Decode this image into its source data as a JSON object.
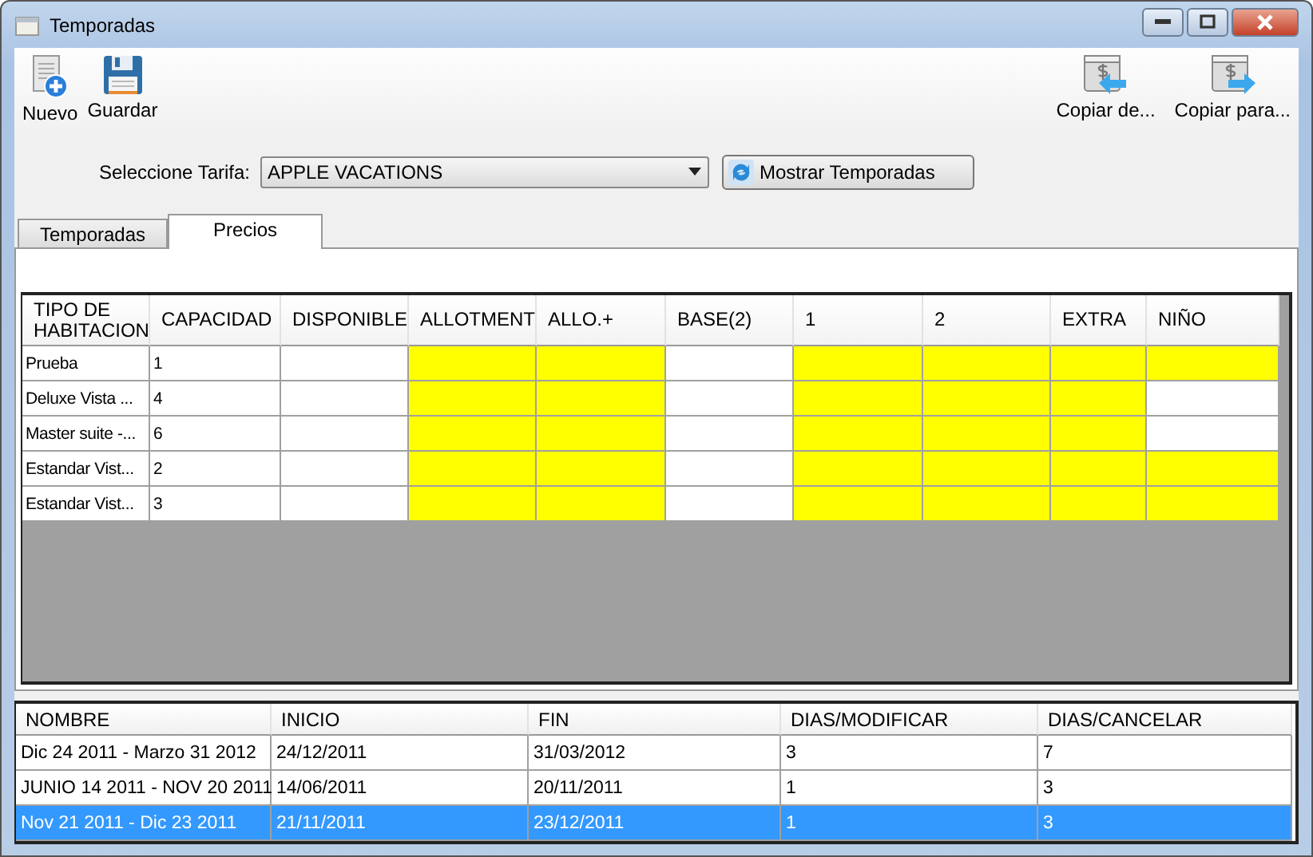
{
  "window": {
    "title": "Temporadas"
  },
  "toolbar_left": [
    {
      "label": "Nuevo",
      "kind": "new"
    },
    {
      "label": "Guardar",
      "kind": "save"
    }
  ],
  "toolbar_right": [
    {
      "label": "Copiar de...",
      "kind": "copy_from"
    },
    {
      "label": "Copiar para...",
      "kind": "copy_to"
    }
  ],
  "tarifa": {
    "label": "Seleccione Tarifa:",
    "value": "APPLE VACATIONS"
  },
  "show_button": {
    "label": "Mostrar Temporadas"
  },
  "tabs": [
    {
      "label": "Temporadas",
      "selected": false
    },
    {
      "label": "Precios",
      "selected": true
    }
  ],
  "prices_table": {
    "columns": [
      "TIPO DE HABITACION",
      "CAPACIDAD",
      "DISPONIBLE",
      "ALLOTMENT",
      "ALLO.+",
      "BASE(2)",
      "1",
      "2",
      "EXTRA",
      "NIÑO"
    ],
    "rows": [
      {
        "cells": [
          {
            "text": "Prueba",
            "highlighted": false
          },
          {
            "text": "1",
            "highlighted": false
          },
          {
            "highlighted": false
          },
          {
            "highlighted": true
          },
          {
            "highlighted": true
          },
          {
            "highlighted": false
          },
          {
            "highlighted": true
          },
          {
            "highlighted": true
          },
          {
            "highlighted": true
          },
          {
            "highlighted": true
          }
        ]
      },
      {
        "cells": [
          {
            "text": "Deluxe Vista ...",
            "highlighted": false
          },
          {
            "text": "4",
            "highlighted": false
          },
          {
            "highlighted": false
          },
          {
            "highlighted": true
          },
          {
            "highlighted": true
          },
          {
            "highlighted": false
          },
          {
            "highlighted": true
          },
          {
            "highlighted": true
          },
          {
            "highlighted": true
          },
          {
            "highlighted": false
          }
        ]
      },
      {
        "cells": [
          {
            "text": "Master suite -...",
            "highlighted": false
          },
          {
            "text": "6",
            "highlighted": false
          },
          {
            "highlighted": false
          },
          {
            "highlighted": true
          },
          {
            "highlighted": true
          },
          {
            "highlighted": false
          },
          {
            "highlighted": true
          },
          {
            "highlighted": true
          },
          {
            "highlighted": true
          },
          {
            "highlighted": false
          }
        ]
      },
      {
        "cells": [
          {
            "text": "Estandar Vist...",
            "highlighted": false
          },
          {
            "text": "2",
            "highlighted": false
          },
          {
            "highlighted": false
          },
          {
            "highlighted": true
          },
          {
            "highlighted": true
          },
          {
            "highlighted": false
          },
          {
            "highlighted": true
          },
          {
            "highlighted": true
          },
          {
            "highlighted": true
          },
          {
            "highlighted": true
          }
        ]
      },
      {
        "cells": [
          {
            "text": "Estandar Vist...",
            "highlighted": false
          },
          {
            "text": "3",
            "highlighted": false
          },
          {
            "highlighted": false
          },
          {
            "highlighted": true
          },
          {
            "highlighted": true
          },
          {
            "highlighted": false
          },
          {
            "highlighted": true
          },
          {
            "highlighted": true
          },
          {
            "highlighted": true
          },
          {
            "highlighted": true
          }
        ]
      }
    ]
  },
  "seasons_table": {
    "columns": [
      "NOMBRE",
      "INICIO",
      "FIN",
      "DIAS/MODIFICAR",
      "DIAS/CANCELAR"
    ],
    "rows": [
      {
        "cells": [
          "Dic 24 2011 - Marzo 31 2012",
          "24/12/2011",
          "31/03/2012",
          "3",
          "7"
        ],
        "selected": false
      },
      {
        "cells": [
          "JUNIO 14 2011 - NOV 20 2011",
          "14/06/2011",
          "20/11/2011",
          "1",
          "3"
        ],
        "selected": false
      },
      {
        "cells": [
          "Nov 21 2011 - Dic 23 2011",
          "21/11/2011",
          "23/12/2011",
          "1",
          "3"
        ],
        "selected": true
      }
    ]
  }
}
